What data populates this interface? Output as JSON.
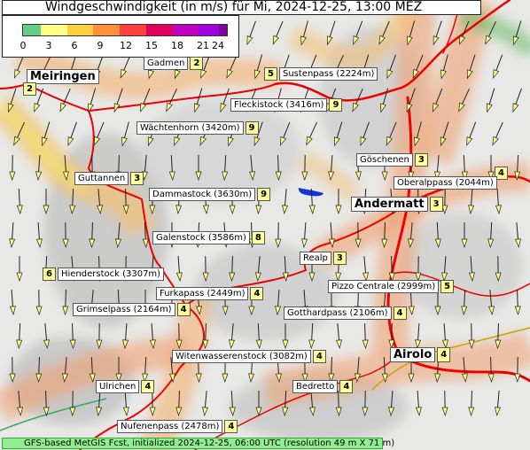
{
  "title": "Windgeschwindigkeit (in m/s) für Mi, 2024-12-25, 13:00 MEZ",
  "legend": {
    "ticks": [
      "0",
      "3",
      "6",
      "9",
      "12",
      "15",
      "18",
      "21",
      "24"
    ],
    "colors": [
      "#66cc88",
      "#ffff88",
      "#ffd040",
      "#ff9040",
      "#ff4040",
      "#e0005a",
      "#c000c0",
      "#a000e0",
      "#8000a0"
    ]
  },
  "places": [
    {
      "name": "Gadmen",
      "value": "2"
    },
    {
      "name": "Meiringen",
      "value": "2"
    },
    {
      "name": "Sustenpass (2224m)",
      "value": "5"
    },
    {
      "name": "Fleckistock (3416m)",
      "value": "9"
    },
    {
      "name": "Wächtenhorn (3420m)",
      "value": "9"
    },
    {
      "name": "Göschenen",
      "value": "3"
    },
    {
      "name": "Guttannen",
      "value": "3"
    },
    {
      "name": "Oberalppass (2044m)",
      "value": "4"
    },
    {
      "name": "Dammastock (3630m)",
      "value": "9"
    },
    {
      "name": "Andermatt",
      "value": "3"
    },
    {
      "name": "Galenstock (3586m)",
      "value": "8"
    },
    {
      "name": "Realp",
      "value": "3"
    },
    {
      "name": "Hienderstock (3307m)",
      "value": "6"
    },
    {
      "name": "Pizzo Centrale (2999m)",
      "value": "5"
    },
    {
      "name": "Furkapass (2449m)",
      "value": "4"
    },
    {
      "name": "Grimselpass (2164m)",
      "value": "4"
    },
    {
      "name": "Gotthardpass (2106m)",
      "value": "4"
    },
    {
      "name": "Witenwasserenstock (3082m)",
      "value": "4"
    },
    {
      "name": "Airolo",
      "value": "4"
    },
    {
      "name": "Ulrichen",
      "value": "4"
    },
    {
      "name": "Bedretto",
      "value": "4"
    },
    {
      "name": "Nufenenpass (2478m)",
      "value": "4"
    }
  ],
  "footer": "GFS-based MetGIS Fcst, initialized 2024-12-25, 06:00 UTC  (resolution 49 m X 71 m)"
}
